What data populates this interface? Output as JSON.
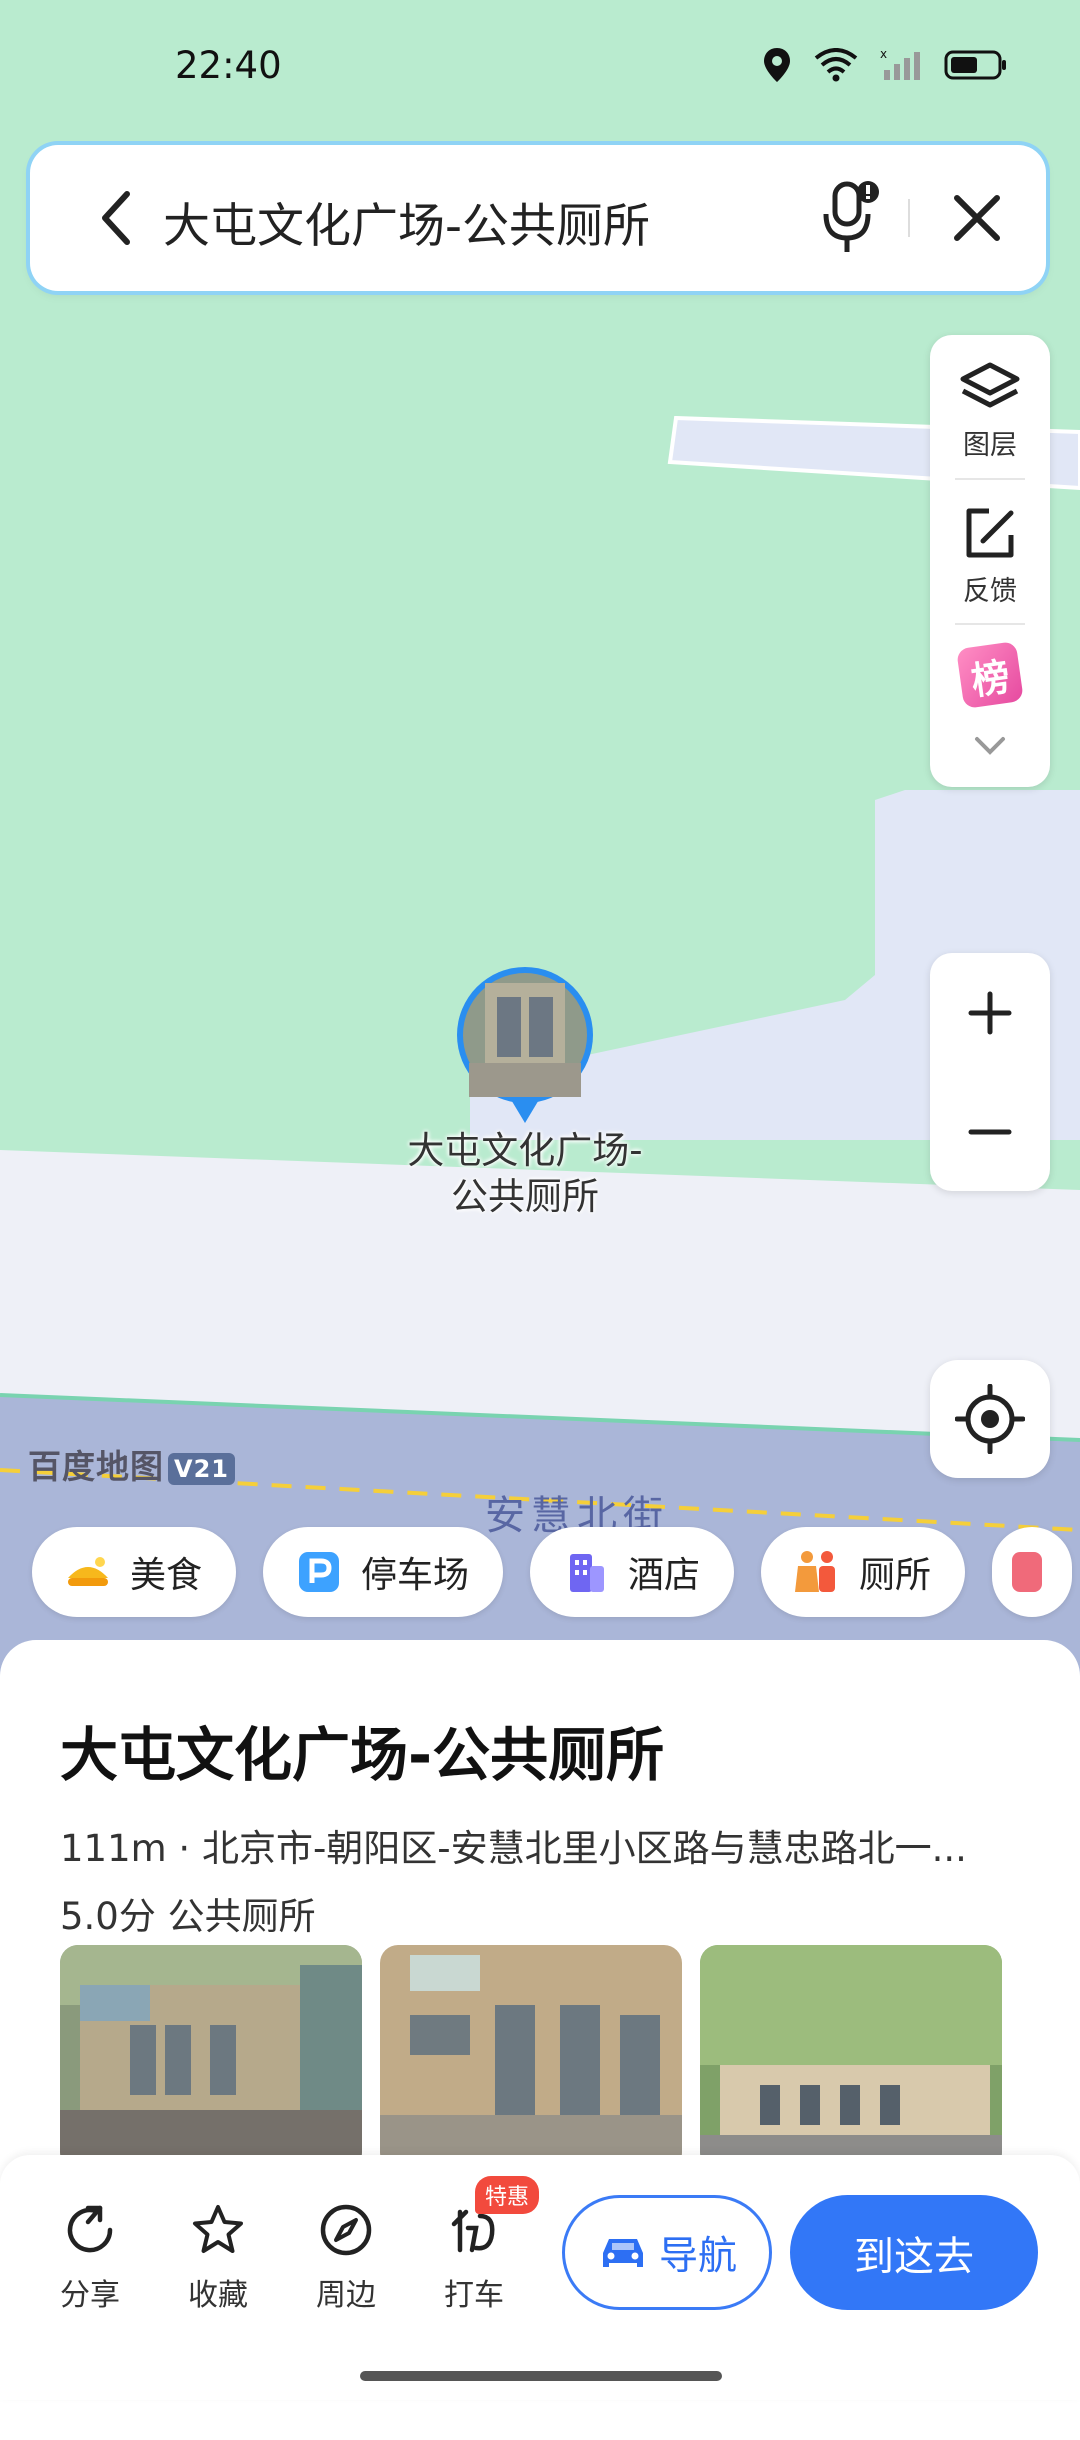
{
  "status_bar": {
    "time": "22:40"
  },
  "search": {
    "query": "大屯文化广场-公共厕所"
  },
  "tools": {
    "layers_label": "图层",
    "feedback_label": "反馈",
    "rank_glyph": "榜"
  },
  "map": {
    "brand": "百度地图",
    "brand_version": "V21",
    "street": "安慧北街",
    "marker_label_line1": "大屯文化广场-",
    "marker_label_line2": "公共厕所"
  },
  "categories": [
    {
      "label": "美食",
      "icon": "food-icon"
    },
    {
      "label": "停车场",
      "icon": "parking-icon"
    },
    {
      "label": "酒店",
      "icon": "hotel-icon"
    },
    {
      "label": "厕所",
      "icon": "toilet-icon"
    }
  ],
  "poi": {
    "title": "大屯文化广场-公共厕所",
    "address": "111m · 北京市-朝阳区-安慧北里小区路与慧忠路北一...",
    "rating": "5.0分",
    "category": "公共厕所"
  },
  "actions": {
    "share": "分享",
    "favorite": "收藏",
    "nearby": "周边",
    "taxi": "打车",
    "deal_badge": "特惠",
    "navigate": "导航",
    "go_here": "到这去"
  },
  "colors": {
    "map_green": "#b9ebcf",
    "road": "#eef0f7",
    "water": "#a6b4d6",
    "primary": "#3277f7"
  }
}
